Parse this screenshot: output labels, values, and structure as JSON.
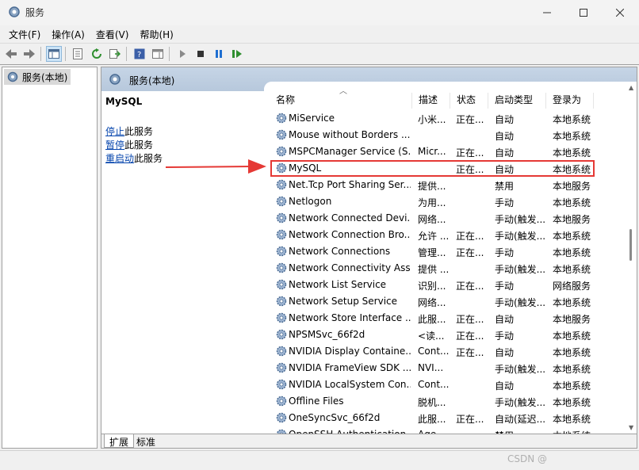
{
  "window": {
    "title": "服务"
  },
  "menu": [
    "文件(F)",
    "操作(A)",
    "查看(V)",
    "帮助(H)"
  ],
  "tree": {
    "root_label": "服务(本地)"
  },
  "content": {
    "header_title": "服务(本地)",
    "selected_service": "MySQL",
    "actions": [
      {
        "link": "停止",
        "rest": "此服务"
      },
      {
        "link": "暂停",
        "rest": "此服务"
      },
      {
        "link": "重启动",
        "rest": "此服务"
      }
    ]
  },
  "table": {
    "columns": [
      "名称",
      "描述",
      "状态",
      "启动类型",
      "登录为"
    ],
    "rows": [
      {
        "name": "MiService",
        "desc": "小米...",
        "status": "正在...",
        "startup": "自动",
        "logon": "本地系统"
      },
      {
        "name": "Mouse without Borders ...",
        "desc": "",
        "status": "",
        "startup": "自动",
        "logon": "本地系统"
      },
      {
        "name": "MSPCManager Service (S...",
        "desc": "Micr...",
        "status": "正在...",
        "startup": "自动",
        "logon": "本地系统"
      },
      {
        "name": "MySQL",
        "desc": "",
        "status": "正在...",
        "startup": "自动",
        "logon": "本地系统",
        "highlight": true
      },
      {
        "name": "Net.Tcp Port Sharing Ser...",
        "desc": "提供...",
        "status": "",
        "startup": "禁用",
        "logon": "本地服务"
      },
      {
        "name": "Netlogon",
        "desc": "为用...",
        "status": "",
        "startup": "手动",
        "logon": "本地系统"
      },
      {
        "name": "Network Connected Devi...",
        "desc": "网络...",
        "status": "",
        "startup": "手动(触发...",
        "logon": "本地服务"
      },
      {
        "name": "Network Connection Bro...",
        "desc": "允许 ...",
        "status": "正在...",
        "startup": "手动(触发...",
        "logon": "本地系统"
      },
      {
        "name": "Network Connections",
        "desc": "管理...",
        "status": "正在...",
        "startup": "手动",
        "logon": "本地系统"
      },
      {
        "name": "Network Connectivity Ass...",
        "desc": "提供 ...",
        "status": "",
        "startup": "手动(触发...",
        "logon": "本地系统"
      },
      {
        "name": "Network List Service",
        "desc": "识别...",
        "status": "正在...",
        "startup": "手动",
        "logon": "网络服务"
      },
      {
        "name": "Network Setup Service",
        "desc": "网络...",
        "status": "",
        "startup": "手动(触发...",
        "logon": "本地系统"
      },
      {
        "name": "Network Store Interface ...",
        "desc": "此服...",
        "status": "正在...",
        "startup": "自动",
        "logon": "本地服务"
      },
      {
        "name": "NPSMSvc_66f2d",
        "desc": "<读...",
        "status": "正在...",
        "startup": "手动",
        "logon": "本地系统"
      },
      {
        "name": "NVIDIA Display Containe...",
        "desc": "Cont...",
        "status": "正在...",
        "startup": "自动",
        "logon": "本地系统"
      },
      {
        "name": "NVIDIA FrameView SDK ...",
        "desc": "NVI...",
        "status": "",
        "startup": "手动(触发...",
        "logon": "本地系统"
      },
      {
        "name": "NVIDIA LocalSystem Con...",
        "desc": "Cont...",
        "status": "",
        "startup": "自动",
        "logon": "本地系统"
      },
      {
        "name": "Offline Files",
        "desc": "脱机...",
        "status": "",
        "startup": "手动(触发...",
        "logon": "本地系统"
      },
      {
        "name": "OneSyncSvc_66f2d",
        "desc": "此服...",
        "status": "正在...",
        "startup": "自动(延迟...",
        "logon": "本地系统"
      },
      {
        "name": "OpenSSH Authentication ...",
        "desc": "Age...",
        "status": "",
        "startup": "禁用",
        "logon": "本地系统"
      }
    ]
  },
  "tabs": [
    "扩展",
    "标准"
  ],
  "watermark": "CSDN @",
  "colors": {
    "highlight": "#e53935",
    "link": "#0645ad",
    "header": "#c6d5e6"
  }
}
